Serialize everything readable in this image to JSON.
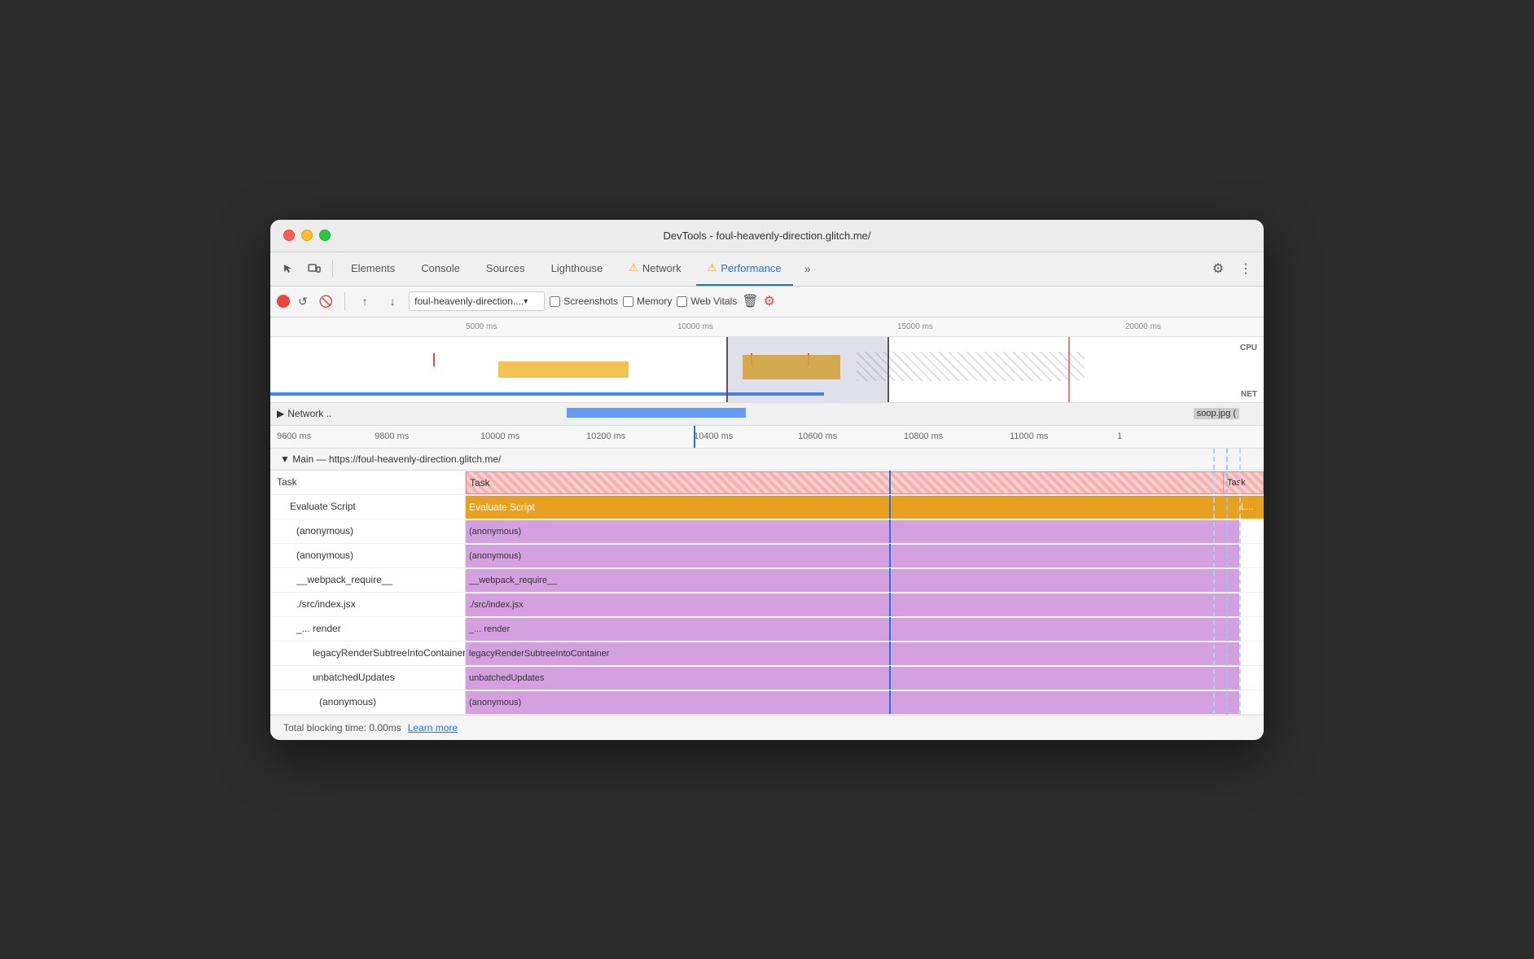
{
  "window": {
    "title": "DevTools - foul-heavenly-direction.glitch.me/"
  },
  "tabs": [
    {
      "label": "Elements",
      "active": false,
      "warning": false
    },
    {
      "label": "Console",
      "active": false,
      "warning": false
    },
    {
      "label": "Sources",
      "active": false,
      "warning": false
    },
    {
      "label": "Lighthouse",
      "active": false,
      "warning": false
    },
    {
      "label": "Network",
      "active": false,
      "warning": true
    },
    {
      "label": "Performance",
      "active": true,
      "warning": true
    }
  ],
  "toolbar": {
    "url": "foul-heavenly-direction....",
    "screenshots_label": "Screenshots",
    "memory_label": "Memory",
    "web_vitals_label": "Web Vitals"
  },
  "ruler_overview": {
    "ticks": [
      "5000 ms",
      "10000 ms",
      "15000 ms",
      "20000 ms"
    ]
  },
  "ruler_detail": {
    "ticks": [
      "9600 ms",
      "9800 ms",
      "10000 ms",
      "10200 ms",
      "10400 ms",
      "10600 ms",
      "10800 ms",
      "11000 ms",
      "1"
    ]
  },
  "network_row": {
    "label": "Network ..",
    "soop_label": "soop.jpg ("
  },
  "flame": {
    "header": "▼ Main — https://foul-heavenly-direction.glitch.me/",
    "rows": [
      {
        "indent": 0,
        "label": "Task",
        "type": "task"
      },
      {
        "indent": 1,
        "label": "Evaluate Script",
        "type": "evaluate"
      },
      {
        "indent": 2,
        "label": "(anonymous)",
        "type": "anon"
      },
      {
        "indent": 2,
        "label": "(anonymous)",
        "type": "anon"
      },
      {
        "indent": 2,
        "label": "__webpack_require__",
        "type": "anon"
      },
      {
        "indent": 2,
        "label": "./src/index.jsx",
        "type": "anon"
      },
      {
        "indent": 2,
        "label": "_...  render",
        "type": "anon"
      },
      {
        "indent": 3,
        "label": "legacyRenderSubtreeIntoContainer",
        "type": "anon"
      },
      {
        "indent": 3,
        "label": "unbatchedUpdates",
        "type": "anon"
      },
      {
        "indent": 3,
        "label": "(anonymous)",
        "type": "anon"
      }
    ]
  },
  "status": {
    "blocking_time": "Total blocking time: 0.00ms",
    "learn_more": "Learn more"
  }
}
